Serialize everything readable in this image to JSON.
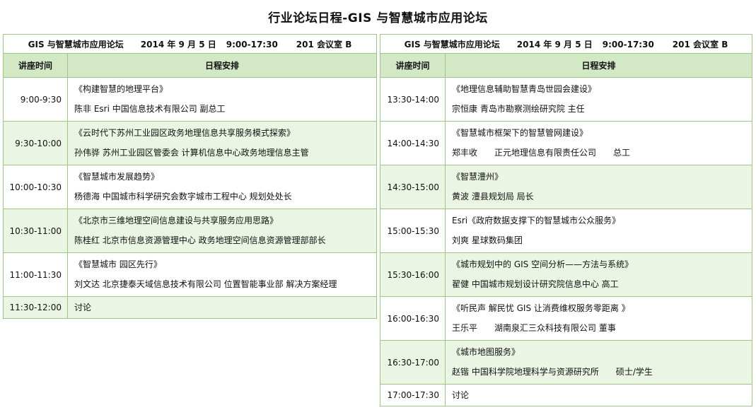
{
  "page_title": "行业论坛日程-GIS 与智慧城市应用论坛",
  "forum": {
    "name": "GIS 与智慧城市应用论坛",
    "date": "2014 年 9 月 5 日",
    "time": "9:00-17:30",
    "room": "201 会议室 B"
  },
  "columns": {
    "time": "讲座时间",
    "agenda": "日程安排"
  },
  "left_sessions": [
    {
      "time": "9:00-9:30",
      "title": "《构建智慧的地理平台》",
      "speaker": "陈非 Esri 中国信息技术有限公司 副总工"
    },
    {
      "time": "9:30-10:00",
      "title": "《云时代下苏州工业园区政务地理信息共享服务模式探索》",
      "speaker": "孙伟骅 苏州工业园区管委会 计算机信息中心政务地理信息主管"
    },
    {
      "time": "10:00-10:30",
      "title": "《智慧城市发展趋势》",
      "speaker": "杨德海 中国城市科学研究会数字城市工程中心 规划处处长"
    },
    {
      "time": "10:30-11:00",
      "title": "《北京市三维地理空间信息建设与共享服务应用思路》",
      "speaker": "陈桂红 北京市信息资源管理中心 政务地理空间信息资源管理部部长"
    },
    {
      "time": "11:00-11:30",
      "title": "《智慧城市 园区先行》",
      "speaker": "刘文达 北京捷泰天域信息技术有限公司 位置智能事业部 解决方案经理"
    },
    {
      "time": "11:30-12:00",
      "title": "讨论",
      "speaker": ""
    }
  ],
  "right_sessions": [
    {
      "time": "13:30-14:00",
      "title": "《地理信息辅助智慧青岛世园会建设》",
      "speaker": "宗恒康 青岛市勘察测绘研究院 主任"
    },
    {
      "time": "14:00-14:30",
      "title": "《智慧城市框架下的智慧管网建设》",
      "speaker_name": "郑丰收",
      "speaker_org": "正元地理信息有限责任公司",
      "speaker_role": "总工"
    },
    {
      "time": "14:30-15:00",
      "title": "《智慧澧州》",
      "speaker": "黄波  澧县规划局 局长"
    },
    {
      "time": "15:00-15:30",
      "title": "Esri《政府数据支撑下的智慧城市公众服务》",
      "speaker": "刘爽 星球数码集团"
    },
    {
      "time": "15:30-16:00",
      "title": "《城市规划中的 GIS 空间分析——方法与系统》",
      "speaker": "翟健  中国城市规划设计研究院信息中心 高工"
    },
    {
      "time": "16:00-16:30",
      "title": "《听民声 解民忧 GIS 让消费维权服务零距离 》",
      "speaker_name": "王乐平",
      "speaker_org": "湖南泉汇三众科技有限公司 董事"
    },
    {
      "time": "16:30-17:00",
      "title": "《城市地图服务》",
      "speaker_name": "赵锴  中国科学院地理科学与资源研究所",
      "speaker_role": "硕士/学生"
    },
    {
      "time": "17:00-17:30",
      "title": "讨论",
      "speaker": ""
    }
  ]
}
